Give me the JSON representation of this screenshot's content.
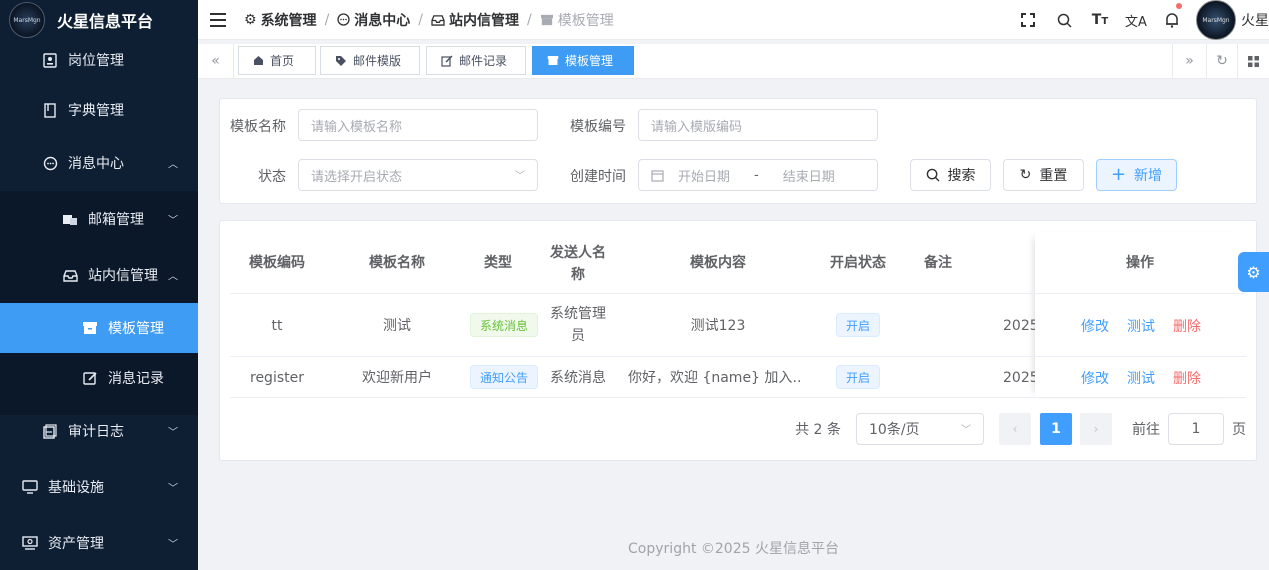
{
  "app": {
    "title": "火星信息平台",
    "logo_text": "MarsMgn"
  },
  "sidebar": {
    "items": [
      {
        "label": "岗位管理",
        "icon": "user-card-icon"
      },
      {
        "label": "字典管理",
        "icon": "book-icon"
      },
      {
        "label": "消息中心",
        "icon": "chat-icon",
        "expanded": true
      },
      {
        "label": "邮箱管理",
        "icon": "mail-box-icon"
      },
      {
        "label": "站内信管理",
        "icon": "inbox-icon",
        "expanded": true
      },
      {
        "label": "模板管理",
        "icon": "box-icon",
        "active": true
      },
      {
        "label": "消息记录",
        "icon": "edit-icon"
      },
      {
        "label": "审计日志",
        "icon": "log-icon"
      },
      {
        "label": "基础设施",
        "icon": "monitor-icon"
      },
      {
        "label": "资产管理",
        "icon": "asset-icon"
      }
    ]
  },
  "header": {
    "breadcrumb": [
      "系统管理",
      "消息中心",
      "站内信管理",
      "模板管理"
    ],
    "username": "火星",
    "notification_dot_color": "#f56c6c"
  },
  "tags": {
    "items": [
      {
        "label": "首页",
        "icon": "home-icon"
      },
      {
        "label": "邮件模版",
        "icon": "tag-icon"
      },
      {
        "label": "邮件记录",
        "icon": "edit-icon"
      },
      {
        "label": "模板管理",
        "icon": "box-icon",
        "active": true
      }
    ]
  },
  "search": {
    "name_label": "模板名称",
    "name_placeholder": "请输入模板名称",
    "code_label": "模板编号",
    "code_placeholder": "请输入模版编码",
    "status_label": "状态",
    "status_placeholder": "请选择开启状态",
    "created_label": "创建时间",
    "start_placeholder": "开始日期",
    "range_sep": "-",
    "end_placeholder": "结束日期",
    "search_btn": "搜索",
    "reset_btn": "重置",
    "add_btn": "新增"
  },
  "table": {
    "headers": [
      "模板编码",
      "模板名称",
      "类型",
      "发送人名称",
      "模板内容",
      "开启状态",
      "备注",
      "操作"
    ],
    "rows": [
      {
        "code": "tt",
        "name": "测试",
        "type": "系统消息",
        "type_color": "green",
        "sender": "系统管理员",
        "content": "测试123",
        "status": "开启",
        "created": "2025-",
        "actions": [
          "修改",
          "测试",
          "删除"
        ]
      },
      {
        "code": "register",
        "name": "欢迎新用户",
        "type": "通知公告",
        "type_color": "blue",
        "sender": "系统消息",
        "content": "你好，欢迎 {name} 加入…",
        "status": "开启",
        "created": "2025-",
        "actions": [
          "修改",
          "测试",
          "删除"
        ]
      }
    ]
  },
  "pagination": {
    "total_text": "共 2 条",
    "page_size": "10条/页",
    "current_page": "1",
    "goto_label": "前往",
    "goto_value": "1",
    "page_unit": "页"
  },
  "footer": {
    "text": "Copyright ©2025 火星信息平台"
  },
  "colors": {
    "sidebar_bg": "#0e1e33",
    "accent": "#3f9cf4",
    "danger": "#f56c6c"
  }
}
